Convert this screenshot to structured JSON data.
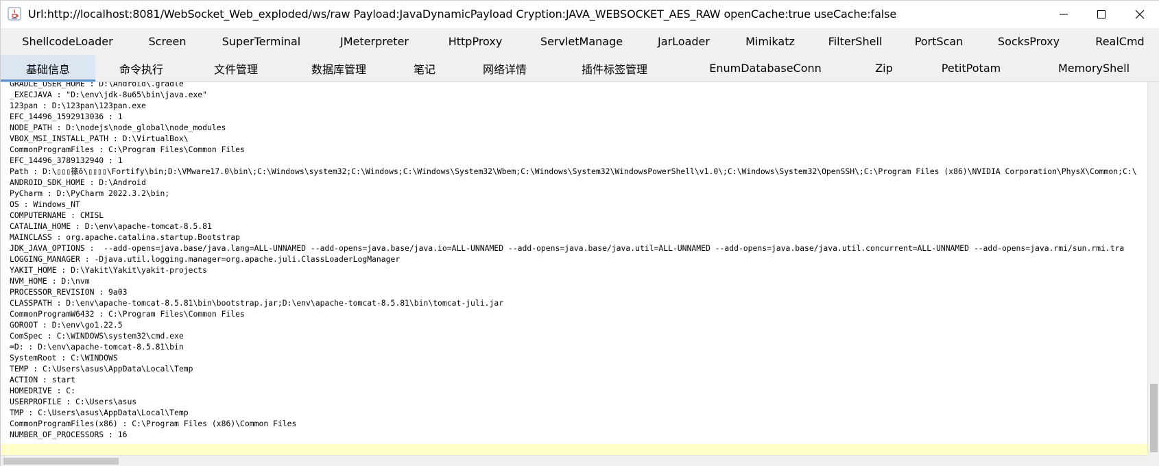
{
  "window": {
    "title": "Url:http://localhost:8081/WebSocket_Web_exploded/ws/raw Payload:JavaDynamicPayload Cryption:JAVA_WEBSOCKET_AES_RAW openCache:true useCache:false",
    "app_icon": "java-app-icon",
    "controls": {
      "minimize": "minimize-icon",
      "maximize": "maximize-icon",
      "close": "close-icon"
    }
  },
  "tabs_row1": [
    {
      "label": "ShellcodeLoader"
    },
    {
      "label": "Screen"
    },
    {
      "label": "SuperTerminal"
    },
    {
      "label": "JMeterpreter"
    },
    {
      "label": "HttpProxy"
    },
    {
      "label": "ServletManage"
    },
    {
      "label": "JarLoader"
    },
    {
      "label": "Mimikatz"
    },
    {
      "label": "FilterShell"
    },
    {
      "label": "PortScan"
    },
    {
      "label": "SocksProxy"
    },
    {
      "label": "RealCmd"
    }
  ],
  "tabs_row2": [
    {
      "label": "基础信息",
      "active": true
    },
    {
      "label": "命令执行"
    },
    {
      "label": "文件管理"
    },
    {
      "label": "数据库管理"
    },
    {
      "label": "笔记"
    },
    {
      "label": "网络详情"
    },
    {
      "label": "插件标签管理"
    },
    {
      "label": "EnumDatabaseConn"
    },
    {
      "label": "Zip"
    },
    {
      "label": "PetitPotam"
    },
    {
      "label": "MemoryShell"
    }
  ],
  "output_lines": [
    "GRADLE_USER_HOME : D:\\Android\\.gradle",
    "_EXECJAVA : \"D:\\env\\jdk-8u65\\bin\\java.exe\"",
    "123pan : D:\\123pan\\123pan.exe",
    "EFC_14496_1592913036 : 1",
    "NODE_PATH : D:\\nodejs\\node_global\\node_modules",
    "VBOX_MSI_INSTALL_PATH : D:\\VirtualBox\\",
    "CommonProgramFiles : C:\\Program Files\\Common Files",
    "EFC_14496_3789132940 : 1",
    "Path : D:\\▯▯▯篠ō\\▯▯▯▯\\Fortify\\bin;D:\\VMware17.0\\bin\\;C:\\Windows\\system32;C:\\Windows;C:\\Windows\\System32\\Wbem;C:\\Windows\\System32\\WindowsPowerShell\\v1.0\\;C:\\Windows\\System32\\OpenSSH\\;C:\\Program Files (x86)\\NVIDIA Corporation\\PhysX\\Common;C:\\",
    "ANDROID_SDK_HOME : D:\\Android",
    "PyCharm : D:\\PyCharm 2022.3.2\\bin;",
    "OS : Windows_NT",
    "COMPUTERNAME : CMISL",
    "CATALINA_HOME : D:\\env\\apache-tomcat-8.5.81",
    "MAINCLASS : org.apache.catalina.startup.Bootstrap",
    "JDK_JAVA_OPTIONS :  --add-opens=java.base/java.lang=ALL-UNNAMED --add-opens=java.base/java.io=ALL-UNNAMED --add-opens=java.base/java.util=ALL-UNNAMED --add-opens=java.base/java.util.concurrent=ALL-UNNAMED --add-opens=java.rmi/sun.rmi.tra",
    "LOGGING_MANAGER : -Djava.util.logging.manager=org.apache.juli.ClassLoaderLogManager",
    "YAKIT_HOME : D:\\Yakit\\Yakit\\yakit-projects",
    "NVM_HOME : D:\\nvm",
    "PROCESSOR_REVISION : 9a03",
    "CLASSPATH : D:\\env\\apache-tomcat-8.5.81\\bin\\bootstrap.jar;D:\\env\\apache-tomcat-8.5.81\\bin\\tomcat-juli.jar",
    "CommonProgramW6432 : C:\\Program Files\\Common Files",
    "GOROOT : D:\\env\\go1.22.5",
    "ComSpec : C:\\WINDOWS\\system32\\cmd.exe",
    "=D: : D:\\env\\apache-tomcat-8.5.81\\bin",
    "SystemRoot : C:\\WINDOWS",
    "TEMP : C:\\Users\\asus\\AppData\\Local\\Temp",
    "ACTION : start",
    "HOMEDRIVE : C:",
    "USERPROFILE : C:\\Users\\asus",
    "TMP : C:\\Users\\asus\\AppData\\Local\\Temp",
    "CommonProgramFiles(x86) : C:\\Program Files (x86)\\Common Files",
    "NUMBER_OF_PROCESSORS : 16"
  ],
  "colors": {
    "tab_active_bg": "#dbe6f2",
    "tab_active_indicator": "#5b8fc7",
    "cursor_line": "#ffffc8"
  }
}
